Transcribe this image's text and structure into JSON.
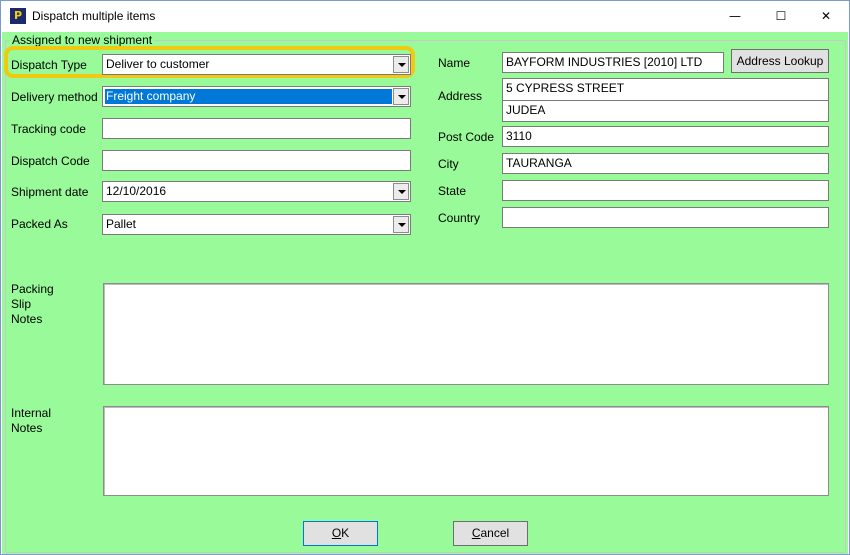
{
  "window": {
    "title": "Dispatch multiple items",
    "app_icon": "P",
    "minimize_glyph": "—",
    "maximize_glyph": "☐",
    "close_glyph": "✕"
  },
  "group": {
    "label": "Assigned to new shipment"
  },
  "left": {
    "dispatch_type": {
      "label": "Dispatch Type",
      "value": "Deliver to customer"
    },
    "delivery_method": {
      "label": "Delivery method",
      "value": "Freight company"
    },
    "tracking_code": {
      "label": "Tracking code",
      "value": ""
    },
    "dispatch_code": {
      "label": "Dispatch Code",
      "value": ""
    },
    "shipment_date": {
      "label": "Shipment date",
      "value": "12/10/2016"
    },
    "packed_as": {
      "label": "Packed As",
      "value": "Pallet"
    }
  },
  "right": {
    "name": {
      "label": "Name",
      "value": "BAYFORM INDUSTRIES [2010] LTD"
    },
    "address_lookup": {
      "label": "Address Lookup"
    },
    "address": {
      "label": "Address",
      "line1": "5 CYPRESS STREET",
      "line2": "JUDEA"
    },
    "post_code": {
      "label": "Post Code",
      "value": "3110"
    },
    "city": {
      "label": "City",
      "value": "TAURANGA"
    },
    "state": {
      "label": "State",
      "value": ""
    },
    "country": {
      "label": "Country",
      "value": ""
    }
  },
  "notes": {
    "packing_slip": {
      "line1": "Packing",
      "line2": "Slip",
      "line3": "Notes"
    },
    "internal": {
      "line1": "Internal",
      "line2": "Notes"
    }
  },
  "buttons": {
    "ok": {
      "accel": "O",
      "rest": "K"
    },
    "cancel": {
      "accel": "C",
      "rest": "ancel"
    }
  },
  "colors": {
    "background": "#98fa98",
    "highlight": "#f2c911",
    "selection": "#0078d7"
  }
}
